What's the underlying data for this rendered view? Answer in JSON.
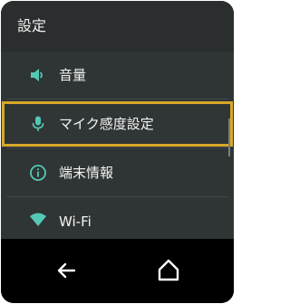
{
  "header": {
    "title": "設定"
  },
  "settings": {
    "items": [
      {
        "label": "音量",
        "icon": "speaker-icon"
      },
      {
        "label": "マイク感度設定",
        "icon": "microphone-icon"
      },
      {
        "label": "端末情報",
        "icon": "info-icon"
      },
      {
        "label": "Wi-Fi",
        "icon": "wifi-icon"
      }
    ],
    "selected": "マイク感度設定"
  },
  "navbar": {
    "back_icon": "back-arrow-icon",
    "home_icon": "home-icon"
  },
  "colors": {
    "accent": "#d8a82a",
    "icon": "#53c8b5",
    "background": "#2f3434",
    "header": "#2a2e2e",
    "navbar": "#000000",
    "text": "#f4f4f4"
  }
}
